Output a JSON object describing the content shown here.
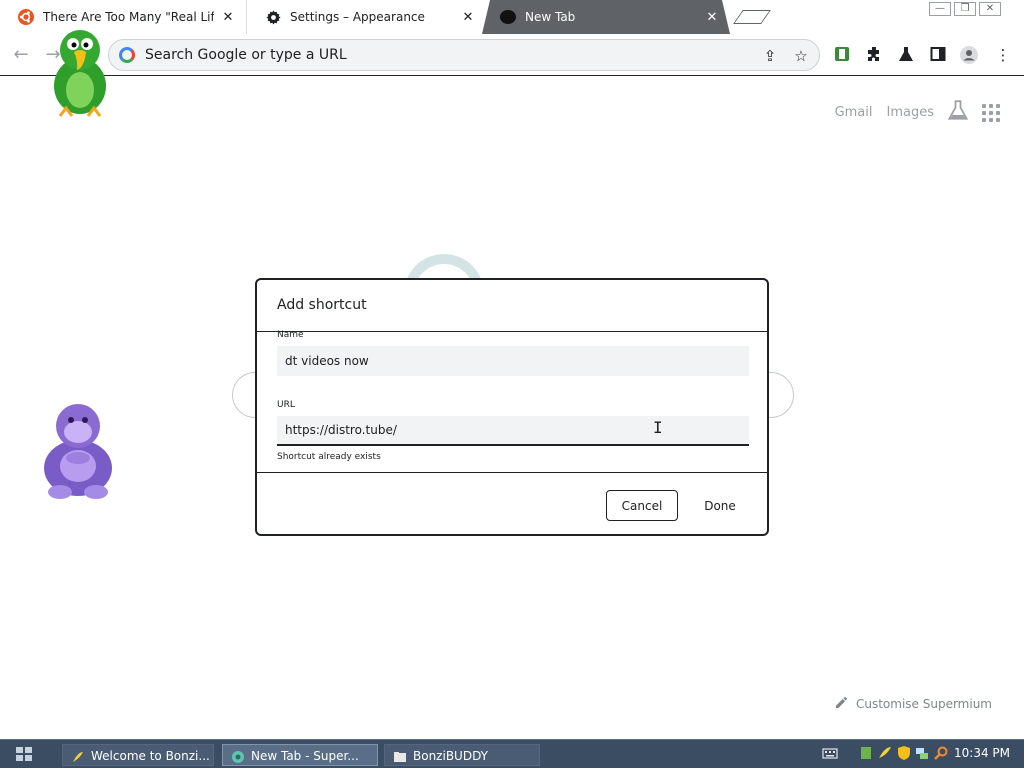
{
  "tabs": [
    {
      "title": "There Are Too Many \"Real Life\"",
      "icon": "ubuntu-icon"
    },
    {
      "title": "Settings – Appearance",
      "icon": "gear-icon"
    },
    {
      "title": "New Tab",
      "icon": "supermium-icon",
      "active": true
    }
  ],
  "toolbar": {
    "omnibox_placeholder": "Search Google or type a URL"
  },
  "ntp": {
    "gmail": "Gmail",
    "images": "Images",
    "customise": "Customise Supermium"
  },
  "dialog": {
    "title": "Add shortcut",
    "name_label": "Name",
    "name_value": "dt videos now",
    "url_label": "URL",
    "url_value": "https://distro.tube/",
    "error": "Shortcut already exists",
    "cancel": "Cancel",
    "done": "Done"
  },
  "taskbar": {
    "tasks": [
      {
        "label": "Welcome to Bonzi...",
        "icon": "bonzi-banana-icon"
      },
      {
        "label": "New Tab - Super...",
        "icon": "supermium-icon",
        "active": true
      },
      {
        "label": "BonziBUDDY",
        "icon": "folder-icon"
      }
    ],
    "clock": "10:34 PM"
  },
  "colors": {
    "active_tab": "#5f6368",
    "taskbar": "#3b4d63",
    "parrot_green": "#2f9e2a",
    "gorilla_purple": "#8a6bd1"
  }
}
